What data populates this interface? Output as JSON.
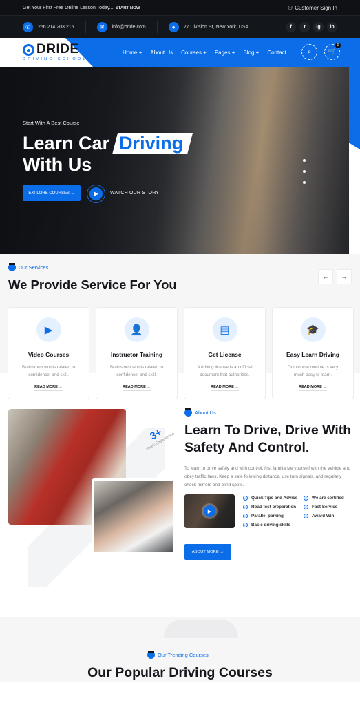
{
  "topbar": {
    "promo": "Get Your First Free Online Lesson Today...",
    "promo_cta": "START NOW",
    "signin": "Customer Sign In"
  },
  "contact": {
    "phone": "256 214 203 215",
    "email": "info@dride.com",
    "address": "27 Division St, New York, USA",
    "social": [
      "f",
      "t",
      "ig",
      "in"
    ]
  },
  "nav": {
    "brand": "DRIDE",
    "tagline": "DRIVING SCHOOL",
    "items": [
      {
        "label": "Home +"
      },
      {
        "label": "About Us"
      },
      {
        "label": "Courses +"
      },
      {
        "label": "Pages +"
      },
      {
        "label": "Blog +"
      },
      {
        "label": "Contact"
      }
    ],
    "cart_count": "0"
  },
  "hero": {
    "subtitle": "Start With A Best Course",
    "title_line1": "Learn Car",
    "title_highlight": "Driving",
    "title_line2": "With Us",
    "explore_label": "EXPLORE COURSES →",
    "watch_label": "WATCH OUR STORY"
  },
  "services": {
    "eyebrow": "Our Services",
    "title": "We Provide Service For You",
    "cards": [
      {
        "icon": "video-icon",
        "glyph": "▶",
        "title": "Video Courses",
        "text": "Brainstorm words related to confidence, and skill.",
        "link": "READ MORE →"
      },
      {
        "icon": "instructor-icon",
        "glyph": "👤",
        "title": "Instructor Training",
        "text": "Brainstorm words related to confidence, and skill.",
        "link": "READ MORE →"
      },
      {
        "icon": "license-icon",
        "glyph": "▤",
        "title": "Get License",
        "text": "A driving license is an official document that authorizes.",
        "link": "READ MORE →"
      },
      {
        "icon": "graduation-icon",
        "glyph": "🎓",
        "title": "Easy Learn Driving",
        "text": "Our course module is very much easy to learn.",
        "link": "READ MORE →"
      }
    ]
  },
  "about": {
    "experience_value": "3+",
    "experience_label": "Years Experience",
    "eyebrow": "About Us",
    "title": "Learn To Drive, Drive With Safety And Control.",
    "text": "To learn to drive safely and with control, first familiarize yourself with the vehicle and obey traffic laws. Keep a safe following distance, use turn signals, and regularly check mirrors and blind spots.",
    "checklist": [
      "Quick Tips and Advice",
      "We are certified",
      "Road test preparation",
      "Fast Service",
      "Parallel parking",
      "Award Win",
      "Basic driving skills"
    ],
    "button": "ABOUT MORE →"
  },
  "trending": {
    "eyebrow": "Our Trending Courses",
    "title": "Our Popular Driving Courses"
  }
}
